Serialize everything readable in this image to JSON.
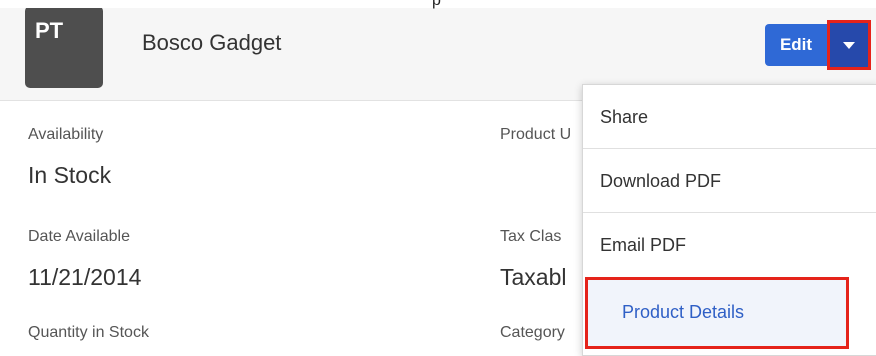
{
  "header": {
    "avatar_initials": "PT",
    "record_name": "Bosco Gadget",
    "edit_label": "Edit",
    "top_clip_mark": "p"
  },
  "fields": {
    "availability": {
      "label": "Availability",
      "value": "In Stock"
    },
    "date_available": {
      "label": "Date Available",
      "value": "11/21/2014"
    },
    "quantity_in_stock": {
      "label": "Quantity in Stock",
      "value": ""
    },
    "product_u": {
      "label": "Product U",
      "value": ""
    },
    "tax_class": {
      "label": "Tax Clas",
      "value": "Taxabl"
    },
    "category": {
      "label": "Category",
      "value": ""
    }
  },
  "menu": {
    "items": [
      "Share",
      "Download PDF",
      "Email PDF",
      "Product Details"
    ]
  },
  "colors": {
    "edit_button": "#2f69d6",
    "caret_button": "#2649ab",
    "highlight": "#e5231a",
    "link": "#2f5fc6",
    "avatar_bg": "#4e4e4e"
  },
  "icons": {
    "caret": "chevron-down-icon"
  }
}
